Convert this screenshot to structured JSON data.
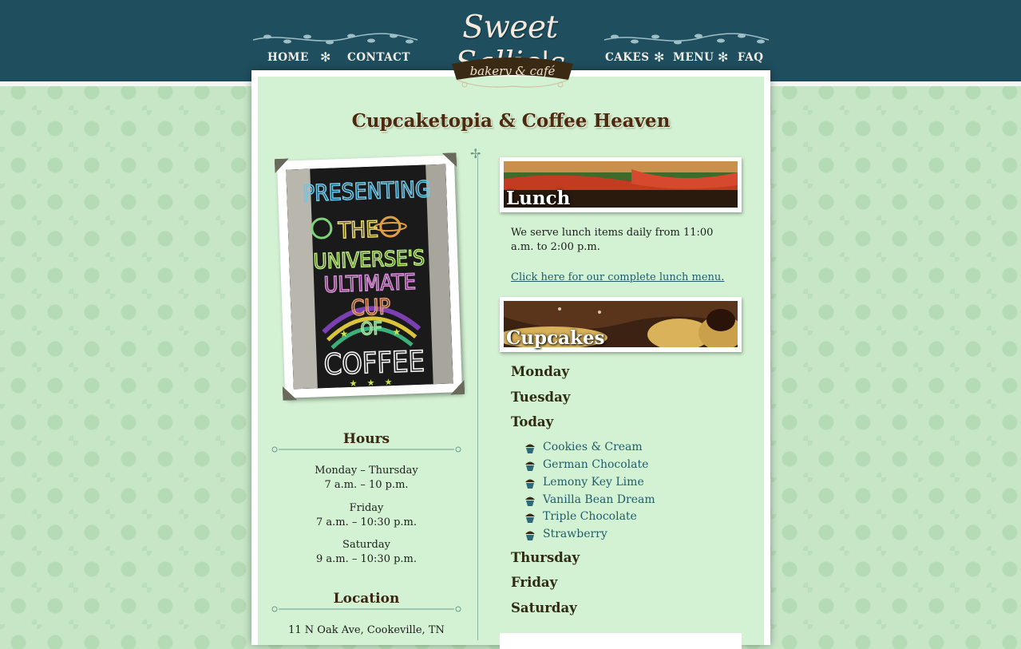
{
  "brand": {
    "name": "Sweet Sallie's",
    "tagline": "bakery & café"
  },
  "nav": {
    "home": "HOME",
    "contact": "CONTACT",
    "cakes": "CAKES",
    "menu": "MENU",
    "faq": "FAQ",
    "separator": "✻"
  },
  "page_title": "Cupcaketopia & Coffee Heaven",
  "photo": {
    "alt_text": "PRESENTING THE UNIVERSE'S ULTIMATE CUP OF COFFEE",
    "lines": [
      "PRESENTING",
      "THE",
      "UNIVERSE'S",
      "ULTIMATE",
      "CUP",
      "OF",
      "COFFEE"
    ]
  },
  "hours": {
    "heading": "Hours",
    "entries": [
      {
        "days": "Monday – Thursday",
        "time": "7 a.m. – 10 p.m."
      },
      {
        "days": "Friday",
        "time": "7 a.m. – 10:30 p.m."
      },
      {
        "days": "Saturday",
        "time": "9 a.m. – 10:30 p.m."
      }
    ]
  },
  "location": {
    "heading": "Location",
    "address": "11 N Oak Ave, Cookeville, TN"
  },
  "lunch": {
    "label": "Lunch",
    "text": "We serve lunch items daily from 11:00 a.m. to 2:00 p.m.",
    "link": "Click here for our complete lunch menu."
  },
  "cupcakes": {
    "label": "Cupcakes",
    "days": [
      "Monday",
      "Tuesday",
      "Today",
      "Thursday",
      "Friday",
      "Saturday"
    ],
    "today_flavors": [
      "Cookies & Cream",
      "German Chocolate",
      "Lemony Key Lime",
      "Vanilla Bean Dream",
      "Triple Chocolate",
      "Strawberry"
    ]
  },
  "colors": {
    "header": "#1f4e5f",
    "panel": "#d3f2d3",
    "link": "#1f5c6b",
    "heading": "#4a2a10"
  }
}
